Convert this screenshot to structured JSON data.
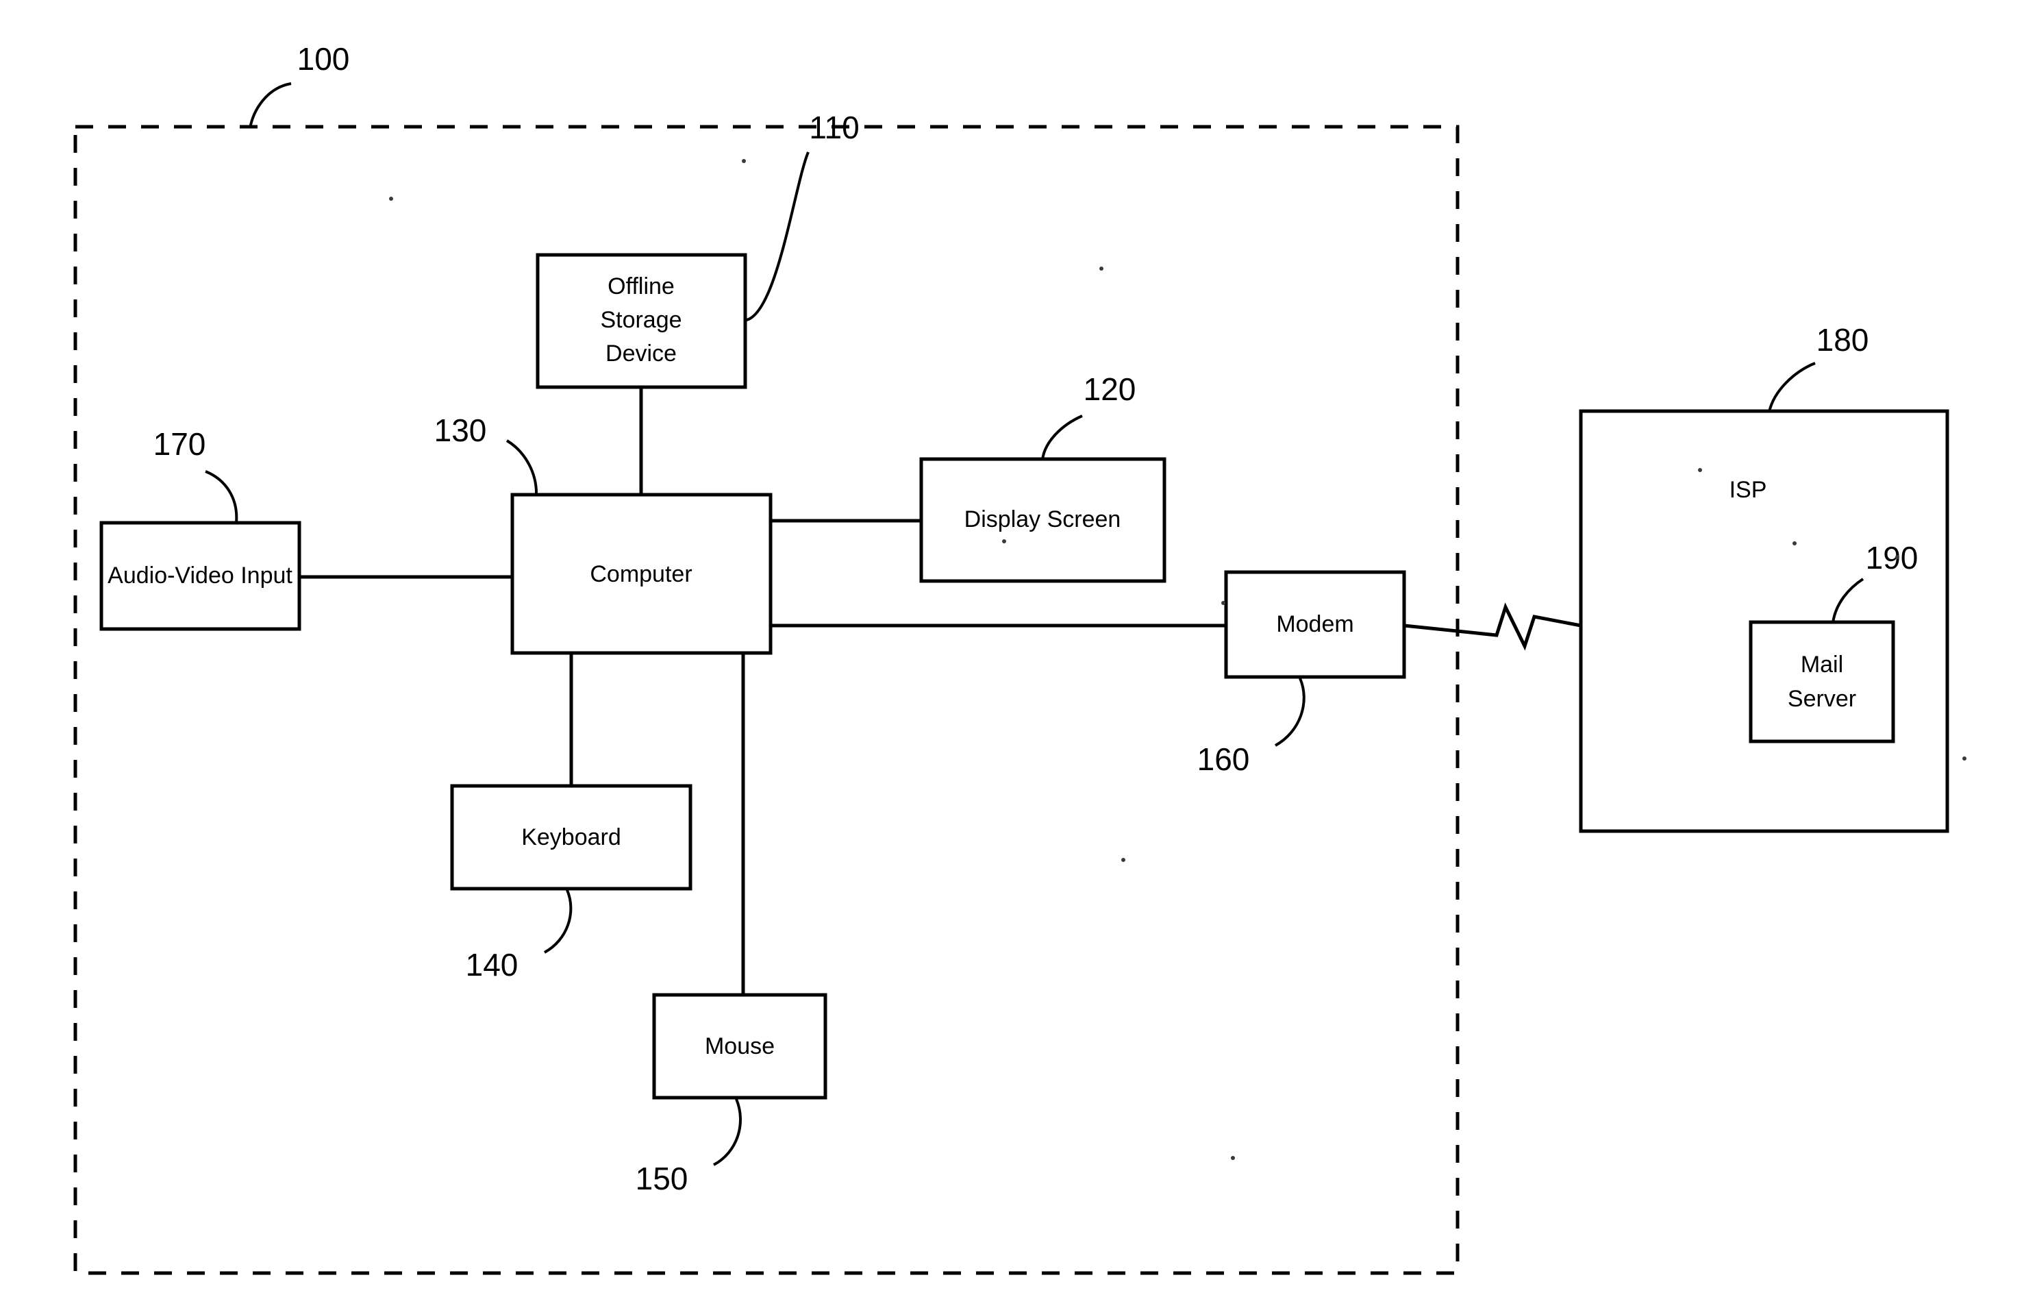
{
  "figure": {
    "title": "Computer system and ISP block diagram",
    "background_color": "#ffffff",
    "line_color": "#000000"
  },
  "boundary": {
    "name": "system-boundary",
    "style": "dashed",
    "ref": "100"
  },
  "nodes": [
    {
      "id": "offline-storage-device",
      "lines": [
        "Offline",
        "Storage",
        "Device"
      ],
      "ref": "110"
    },
    {
      "id": "computer",
      "lines": [
        "Computer"
      ],
      "ref": "130"
    },
    {
      "id": "display-screen",
      "lines": [
        "Display Screen"
      ],
      "ref": "120"
    },
    {
      "id": "audio-video-input",
      "lines": [
        "Audio-Video Input"
      ],
      "ref": "170"
    },
    {
      "id": "keyboard",
      "lines": [
        "Keyboard"
      ],
      "ref": "140"
    },
    {
      "id": "mouse",
      "lines": [
        "Mouse"
      ],
      "ref": "150"
    },
    {
      "id": "modem",
      "lines": [
        "Modem"
      ],
      "ref": "160"
    },
    {
      "id": "isp",
      "lines": [
        "ISP"
      ],
      "ref": "180"
    },
    {
      "id": "mail-server",
      "lines": [
        "Mail",
        "Server"
      ],
      "ref": "190"
    }
  ],
  "labels": {
    "offline_storage_l1": "Offline",
    "offline_storage_l2": "Storage",
    "offline_storage_l3": "Device",
    "computer": "Computer",
    "display_screen": "Display Screen",
    "audio_video_input": "Audio-Video Input",
    "keyboard": "Keyboard",
    "mouse": "Mouse",
    "modem": "Modem",
    "isp": "ISP",
    "mail_server_l1": "Mail",
    "mail_server_l2": "Server"
  },
  "refs": {
    "system": "100",
    "offline_storage": "110",
    "display_screen": "120",
    "computer": "130",
    "keyboard": "140",
    "mouse": "150",
    "modem": "160",
    "audio_video_input": "170",
    "isp": "180",
    "mail_server": "190"
  },
  "connections": [
    {
      "from": "offline-storage-device",
      "to": "computer"
    },
    {
      "from": "audio-video-input",
      "to": "computer"
    },
    {
      "from": "computer",
      "to": "display-screen"
    },
    {
      "from": "computer",
      "to": "keyboard"
    },
    {
      "from": "computer",
      "to": "mouse"
    },
    {
      "from": "computer",
      "to": "modem"
    },
    {
      "from": "modem",
      "to": "isp",
      "style": "broken-link-zigzag"
    }
  ]
}
